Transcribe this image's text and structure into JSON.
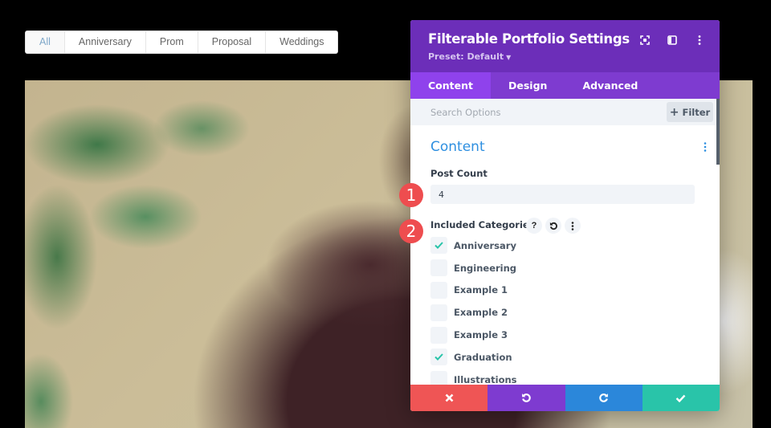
{
  "filter_bar": {
    "items": [
      {
        "label": "All",
        "active": true
      },
      {
        "label": "Anniversary",
        "active": false
      },
      {
        "label": "Prom",
        "active": false
      },
      {
        "label": "Proposal",
        "active": false
      },
      {
        "label": "Weddings",
        "active": false
      }
    ]
  },
  "panel": {
    "title": "Filterable Portfolio Settings",
    "preset": "Preset: Default",
    "header_icons": [
      "fullscreen-icon",
      "sidebar-toggle-icon",
      "more-vertical-icon"
    ],
    "tabs": [
      {
        "label": "Content",
        "active": true
      },
      {
        "label": "Design",
        "active": false
      },
      {
        "label": "Advanced",
        "active": false
      }
    ],
    "search": {
      "placeholder": "Search Options",
      "value": ""
    },
    "filter_label": "Filter",
    "section_title": "Content",
    "post_count": {
      "label": "Post Count",
      "value": "4"
    },
    "included_categories": {
      "label": "Included Categories",
      "items": [
        {
          "label": "Anniversary",
          "checked": true
        },
        {
          "label": "Engineering",
          "checked": false
        },
        {
          "label": "Example 1",
          "checked": false
        },
        {
          "label": "Example 2",
          "checked": false
        },
        {
          "label": "Example 3",
          "checked": false
        },
        {
          "label": "Graduation",
          "checked": true
        },
        {
          "label": "Illustrations",
          "checked": false
        }
      ]
    },
    "footer": [
      "cancel",
      "undo",
      "redo",
      "save"
    ]
  },
  "badges": [
    "1",
    "2"
  ],
  "colors": {
    "header": "#6c2eb9",
    "tabs": "#7e3bd0",
    "tab_active": "#8f42ec",
    "accent_blue": "#2e8fe0",
    "check": "#29c4a9",
    "cancel": "#ef5555",
    "undo": "#7e3bd0",
    "redo": "#2b87da",
    "save": "#29c4a9",
    "badge": "#ee4d4f"
  }
}
